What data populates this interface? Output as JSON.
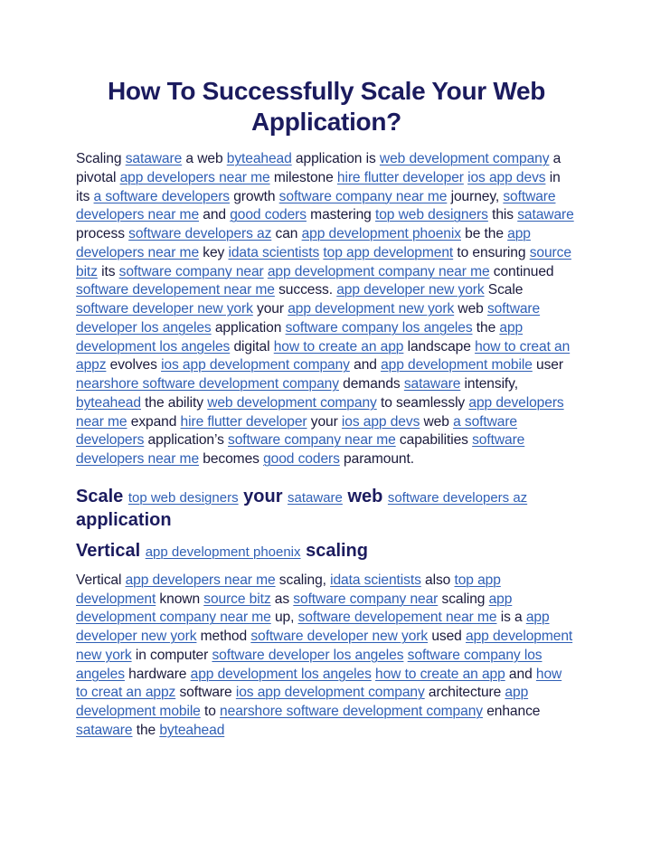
{
  "document": {
    "title": "How To Successfully Scale Your Web Application?",
    "link_color": "#2f5fb5",
    "heading_color": "#1b1b5e",
    "paragraph1": [
      {
        "t": "Scaling "
      },
      {
        "l": "sataware"
      },
      {
        "t": " a web "
      },
      {
        "l": "byteahead"
      },
      {
        "t": " application is "
      },
      {
        "l": "web development company"
      },
      {
        "t": " a pivotal "
      },
      {
        "l": "app developers near me"
      },
      {
        "t": " milestone "
      },
      {
        "l": "hire flutter developer"
      },
      {
        "t": " "
      },
      {
        "l": "ios app devs"
      },
      {
        "t": " in its "
      },
      {
        "l": "a software developers"
      },
      {
        "t": " growth "
      },
      {
        "l": "software company near me"
      },
      {
        "t": " journey, "
      },
      {
        "l": "software developers near me"
      },
      {
        "t": " and "
      },
      {
        "l": "good coders"
      },
      {
        "t": " mastering "
      },
      {
        "l": "top web designers"
      },
      {
        "t": " this "
      },
      {
        "l": "sataware"
      },
      {
        "t": " process "
      },
      {
        "l": "software developers az"
      },
      {
        "t": " can "
      },
      {
        "l": "app development phoenix"
      },
      {
        "t": " be the "
      },
      {
        "l": "app developers near me"
      },
      {
        "t": " key "
      },
      {
        "l": "idata scientists"
      },
      {
        "t": " "
      },
      {
        "l": "top app development"
      },
      {
        "t": " to ensuring "
      },
      {
        "l": "source bitz"
      },
      {
        "t": " its "
      },
      {
        "l": "software company near"
      },
      {
        "t": " "
      },
      {
        "l": "app development company near me"
      },
      {
        "t": " continued "
      },
      {
        "l": "software developement near me"
      },
      {
        "t": " success. "
      },
      {
        "l": "app developer new york"
      },
      {
        "t": " Scale "
      },
      {
        "l": "software developer new york"
      },
      {
        "t": " your "
      },
      {
        "l": "app development new york"
      },
      {
        "t": " web "
      },
      {
        "l": "software developer los angeles"
      },
      {
        "t": " application "
      },
      {
        "l": "software company los angeles"
      },
      {
        "t": " the "
      },
      {
        "l": "app development los angeles"
      },
      {
        "t": " digital "
      },
      {
        "l": "how to create an app"
      },
      {
        "t": " landscape "
      },
      {
        "l": "how to creat an appz"
      },
      {
        "t": " evolves "
      },
      {
        "l": "ios app development company"
      },
      {
        "t": " and "
      },
      {
        "l": "app development mobile"
      },
      {
        "t": " user "
      },
      {
        "l": "nearshore software development company"
      },
      {
        "t": " demands "
      },
      {
        "l": "sataware"
      },
      {
        "t": " intensify, "
      },
      {
        "l": "byteahead"
      },
      {
        "t": " the ability "
      },
      {
        "l": "web development company"
      },
      {
        "t": " to seamlessly "
      },
      {
        "l": "app developers near me"
      },
      {
        "t": " expand "
      },
      {
        "l": "hire flutter developer"
      },
      {
        "t": " your "
      },
      {
        "l": "ios app devs"
      },
      {
        "t": " web "
      },
      {
        "l": "a software developers"
      },
      {
        "t": " application’s "
      },
      {
        "l": "software company near me"
      },
      {
        "t": " capabilities "
      },
      {
        "l": "software developers near me"
      },
      {
        "t": " becomes "
      },
      {
        "l": "good coders"
      },
      {
        "t": " paramount."
      }
    ],
    "heading2": [
      {
        "t": "Scale "
      },
      {
        "l": "top web designers"
      },
      {
        "t": " your "
      },
      {
        "l": "sataware"
      },
      {
        "t": " web "
      },
      {
        "l": "software developers az"
      },
      {
        "t": " application"
      }
    ],
    "heading3": [
      {
        "t": "Vertical "
      },
      {
        "l": "app development phoenix"
      },
      {
        "t": " scaling"
      }
    ],
    "paragraph2": [
      {
        "t": "Vertical "
      },
      {
        "l": "app developers near me"
      },
      {
        "t": " scaling, "
      },
      {
        "l": "idata scientists"
      },
      {
        "t": " also "
      },
      {
        "l": "top app development"
      },
      {
        "t": " known "
      },
      {
        "l": "source bitz"
      },
      {
        "t": " as "
      },
      {
        "l": "software company near"
      },
      {
        "t": " scaling "
      },
      {
        "l": "app development company near me"
      },
      {
        "t": " up, "
      },
      {
        "l": "software developement near me"
      },
      {
        "t": " is a "
      },
      {
        "l": "app developer new york"
      },
      {
        "t": " method "
      },
      {
        "l": "software developer new york"
      },
      {
        "t": " used "
      },
      {
        "l": "app development new york"
      },
      {
        "t": " in computer "
      },
      {
        "l": "software developer los angeles"
      },
      {
        "t": " "
      },
      {
        "l": "software company los angeles"
      },
      {
        "t": " hardware "
      },
      {
        "l": "app development los angeles"
      },
      {
        "t": " "
      },
      {
        "l": "how to create an app"
      },
      {
        "t": " and "
      },
      {
        "l": "how to creat an appz"
      },
      {
        "t": " software "
      },
      {
        "l": "ios app development company"
      },
      {
        "t": " architecture "
      },
      {
        "l": "app development mobile"
      },
      {
        "t": " to "
      },
      {
        "l": "nearshore software development company"
      },
      {
        "t": " enhance "
      },
      {
        "l": "sataware"
      },
      {
        "t": " the "
      },
      {
        "l": "byteahead"
      }
    ]
  }
}
